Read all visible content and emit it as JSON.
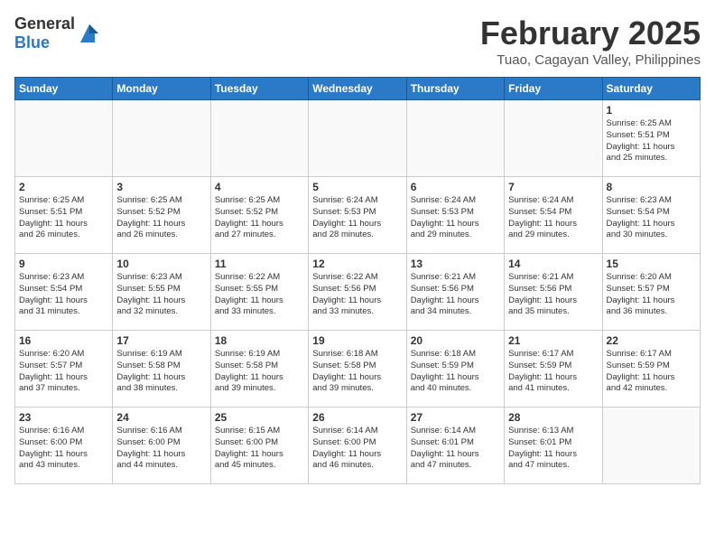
{
  "header": {
    "logo_general": "General",
    "logo_blue": "Blue",
    "month_year": "February 2025",
    "location": "Tuao, Cagayan Valley, Philippines"
  },
  "days_of_week": [
    "Sunday",
    "Monday",
    "Tuesday",
    "Wednesday",
    "Thursday",
    "Friday",
    "Saturday"
  ],
  "weeks": [
    [
      {
        "day": "",
        "info": ""
      },
      {
        "day": "",
        "info": ""
      },
      {
        "day": "",
        "info": ""
      },
      {
        "day": "",
        "info": ""
      },
      {
        "day": "",
        "info": ""
      },
      {
        "day": "",
        "info": ""
      },
      {
        "day": "1",
        "info": "Sunrise: 6:25 AM\nSunset: 5:51 PM\nDaylight: 11 hours\nand 25 minutes."
      }
    ],
    [
      {
        "day": "2",
        "info": "Sunrise: 6:25 AM\nSunset: 5:51 PM\nDaylight: 11 hours\nand 26 minutes."
      },
      {
        "day": "3",
        "info": "Sunrise: 6:25 AM\nSunset: 5:52 PM\nDaylight: 11 hours\nand 26 minutes."
      },
      {
        "day": "4",
        "info": "Sunrise: 6:25 AM\nSunset: 5:52 PM\nDaylight: 11 hours\nand 27 minutes."
      },
      {
        "day": "5",
        "info": "Sunrise: 6:24 AM\nSunset: 5:53 PM\nDaylight: 11 hours\nand 28 minutes."
      },
      {
        "day": "6",
        "info": "Sunrise: 6:24 AM\nSunset: 5:53 PM\nDaylight: 11 hours\nand 29 minutes."
      },
      {
        "day": "7",
        "info": "Sunrise: 6:24 AM\nSunset: 5:54 PM\nDaylight: 11 hours\nand 29 minutes."
      },
      {
        "day": "8",
        "info": "Sunrise: 6:23 AM\nSunset: 5:54 PM\nDaylight: 11 hours\nand 30 minutes."
      }
    ],
    [
      {
        "day": "9",
        "info": "Sunrise: 6:23 AM\nSunset: 5:54 PM\nDaylight: 11 hours\nand 31 minutes."
      },
      {
        "day": "10",
        "info": "Sunrise: 6:23 AM\nSunset: 5:55 PM\nDaylight: 11 hours\nand 32 minutes."
      },
      {
        "day": "11",
        "info": "Sunrise: 6:22 AM\nSunset: 5:55 PM\nDaylight: 11 hours\nand 33 minutes."
      },
      {
        "day": "12",
        "info": "Sunrise: 6:22 AM\nSunset: 5:56 PM\nDaylight: 11 hours\nand 33 minutes."
      },
      {
        "day": "13",
        "info": "Sunrise: 6:21 AM\nSunset: 5:56 PM\nDaylight: 11 hours\nand 34 minutes."
      },
      {
        "day": "14",
        "info": "Sunrise: 6:21 AM\nSunset: 5:56 PM\nDaylight: 11 hours\nand 35 minutes."
      },
      {
        "day": "15",
        "info": "Sunrise: 6:20 AM\nSunset: 5:57 PM\nDaylight: 11 hours\nand 36 minutes."
      }
    ],
    [
      {
        "day": "16",
        "info": "Sunrise: 6:20 AM\nSunset: 5:57 PM\nDaylight: 11 hours\nand 37 minutes."
      },
      {
        "day": "17",
        "info": "Sunrise: 6:19 AM\nSunset: 5:58 PM\nDaylight: 11 hours\nand 38 minutes."
      },
      {
        "day": "18",
        "info": "Sunrise: 6:19 AM\nSunset: 5:58 PM\nDaylight: 11 hours\nand 39 minutes."
      },
      {
        "day": "19",
        "info": "Sunrise: 6:18 AM\nSunset: 5:58 PM\nDaylight: 11 hours\nand 39 minutes."
      },
      {
        "day": "20",
        "info": "Sunrise: 6:18 AM\nSunset: 5:59 PM\nDaylight: 11 hours\nand 40 minutes."
      },
      {
        "day": "21",
        "info": "Sunrise: 6:17 AM\nSunset: 5:59 PM\nDaylight: 11 hours\nand 41 minutes."
      },
      {
        "day": "22",
        "info": "Sunrise: 6:17 AM\nSunset: 5:59 PM\nDaylight: 11 hours\nand 42 minutes."
      }
    ],
    [
      {
        "day": "23",
        "info": "Sunrise: 6:16 AM\nSunset: 6:00 PM\nDaylight: 11 hours\nand 43 minutes."
      },
      {
        "day": "24",
        "info": "Sunrise: 6:16 AM\nSunset: 6:00 PM\nDaylight: 11 hours\nand 44 minutes."
      },
      {
        "day": "25",
        "info": "Sunrise: 6:15 AM\nSunset: 6:00 PM\nDaylight: 11 hours\nand 45 minutes."
      },
      {
        "day": "26",
        "info": "Sunrise: 6:14 AM\nSunset: 6:00 PM\nDaylight: 11 hours\nand 46 minutes."
      },
      {
        "day": "27",
        "info": "Sunrise: 6:14 AM\nSunset: 6:01 PM\nDaylight: 11 hours\nand 47 minutes."
      },
      {
        "day": "28",
        "info": "Sunrise: 6:13 AM\nSunset: 6:01 PM\nDaylight: 11 hours\nand 47 minutes."
      },
      {
        "day": "",
        "info": ""
      }
    ]
  ]
}
